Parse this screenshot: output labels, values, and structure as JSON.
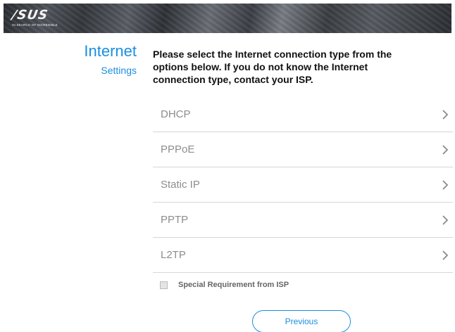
{
  "brand": {
    "logo_text": "/SUS",
    "tagline": "IN SEARCH OF INCREDIBLE"
  },
  "page": {
    "title": "Internet",
    "subtitle": "Settings",
    "instructions": "Please select the Internet connection type from the options below. If you do not know the Internet connection type, contact your ISP."
  },
  "connection_types": [
    {
      "label": "DHCP",
      "icon": "chevron-right-icon"
    },
    {
      "label": "PPPoE",
      "icon": "chevron-right-icon"
    },
    {
      "label": "Static IP",
      "icon": "chevron-right-icon"
    },
    {
      "label": "PPTP",
      "icon": "chevron-right-icon"
    },
    {
      "label": "L2TP",
      "icon": "chevron-right-icon"
    }
  ],
  "special_requirement": {
    "label": "Special Requirement from ISP",
    "checked": false
  },
  "buttons": {
    "previous": "Previous"
  },
  "colors": {
    "accent": "#1a8ee0",
    "option_text": "#8d8d8d",
    "divider": "#d6d6d6"
  }
}
